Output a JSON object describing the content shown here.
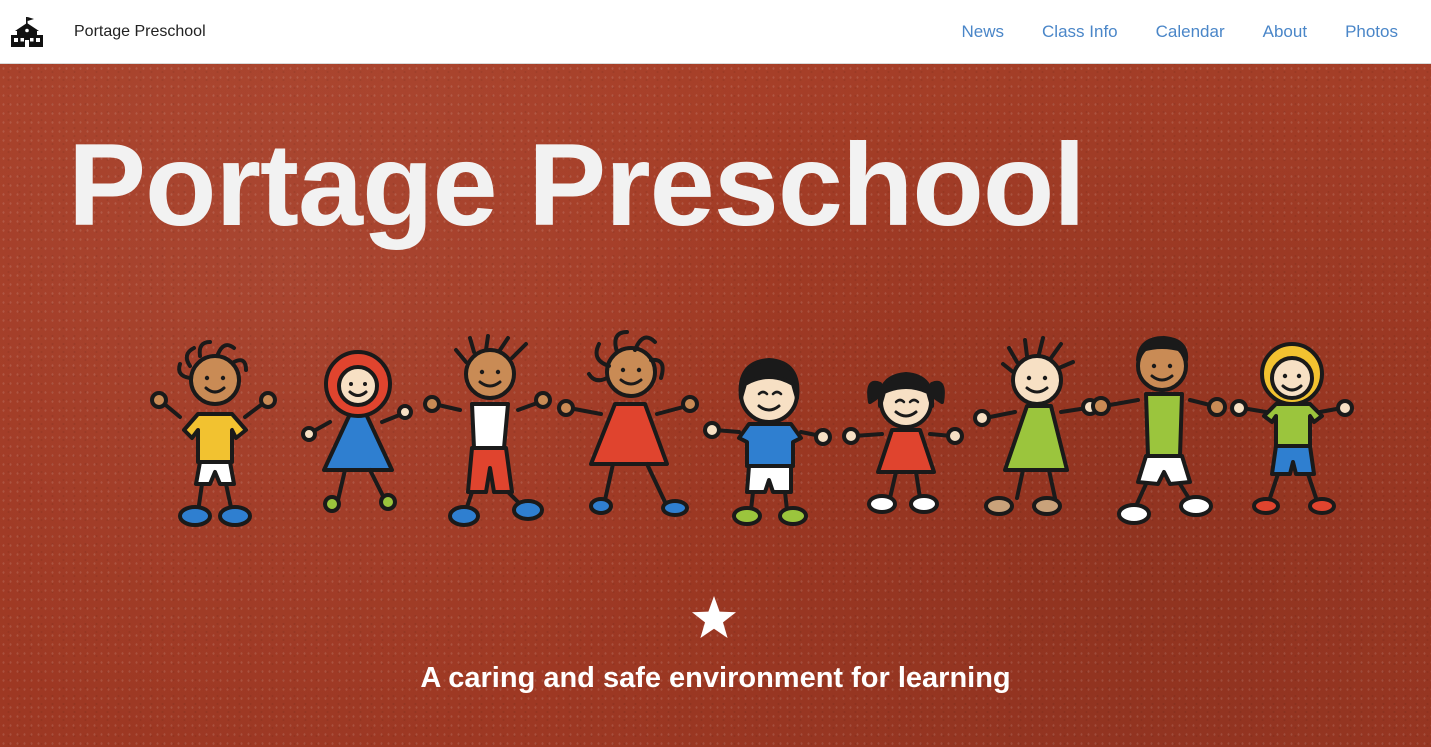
{
  "navbar": {
    "brand_name": "Portage Preschool",
    "brand_icon": "schoolhouse-icon",
    "links": [
      "News",
      "Class Info",
      "Calendar",
      "About",
      "Photos"
    ]
  },
  "hero": {
    "title": "Portage Preschool",
    "illustration": "children-holding-hands",
    "star_icon": "star-icon",
    "tagline": "A caring and safe environment for learning"
  },
  "colors": {
    "nav_link": "#4a86c8",
    "hero_background": "#a63d27",
    "hero_text": "#f2f2f2"
  }
}
